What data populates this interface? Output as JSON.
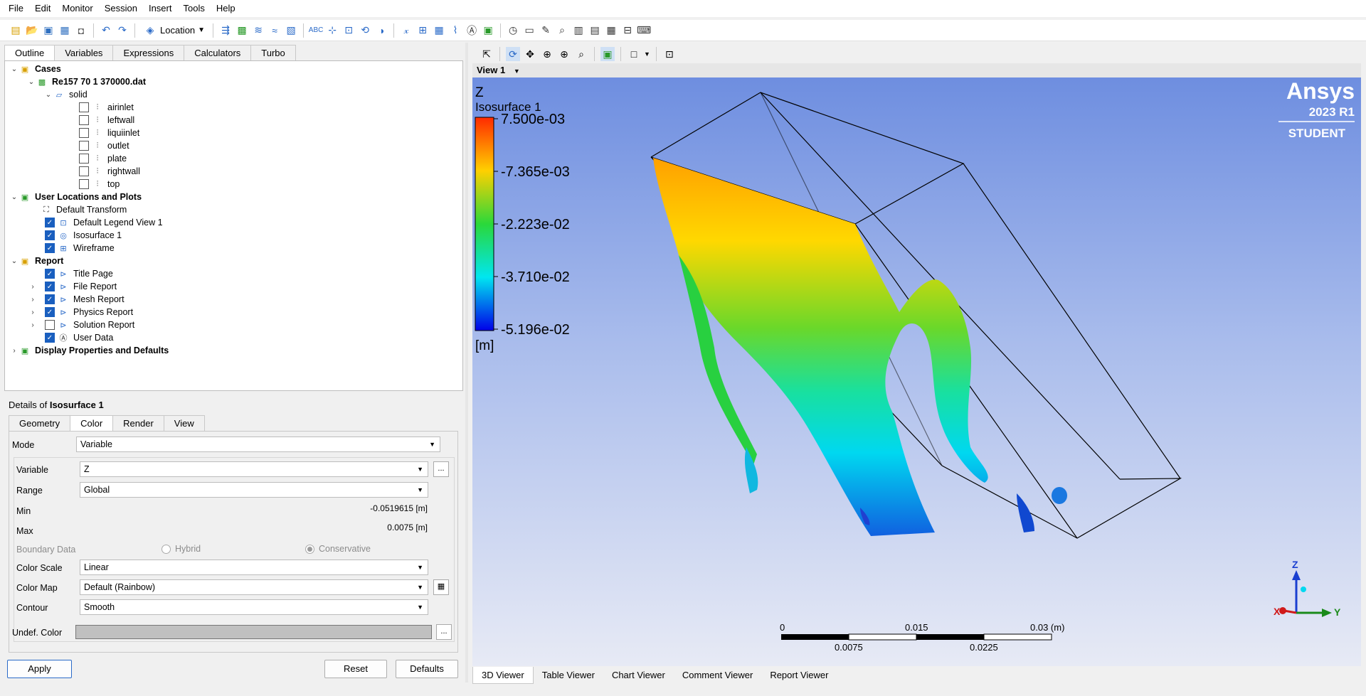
{
  "menu": [
    "File",
    "Edit",
    "Monitor",
    "Session",
    "Insert",
    "Tools",
    "Help"
  ],
  "toolbar": {
    "location_label": "Location"
  },
  "outline_tabs": [
    "Outline",
    "Variables",
    "Expressions",
    "Calculators",
    "Turbo"
  ],
  "tree": {
    "cases": "Cases",
    "case_file": "Re157 70 1 370000.dat",
    "domain": "solid",
    "boundaries": [
      "airinlet",
      "leftwall",
      "liquiinlet",
      "outlet",
      "plate",
      "rightwall",
      "top"
    ],
    "user_locations": "User Locations and Plots",
    "default_transform": "Default Transform",
    "legend": "Default Legend View 1",
    "isosurface": "Isosurface 1",
    "wireframe": "Wireframe",
    "report": "Report",
    "report_items": [
      {
        "label": "Title Page",
        "checked": true
      },
      {
        "label": "File Report",
        "checked": true
      },
      {
        "label": "Mesh Report",
        "checked": true
      },
      {
        "label": "Physics Report",
        "checked": true
      },
      {
        "label": "Solution Report",
        "checked": false
      },
      {
        "label": "User Data",
        "checked": true
      }
    ],
    "display_props": "Display Properties and Defaults"
  },
  "details": {
    "title_prefix": "Details of",
    "title_object": "Isosurface 1",
    "tabs": [
      "Geometry",
      "Color",
      "Render",
      "View"
    ],
    "mode_label": "Mode",
    "mode_value": "Variable",
    "variable_label": "Variable",
    "variable_value": "Z",
    "range_label": "Range",
    "range_value": "Global",
    "min_label": "Min",
    "min_value": "-0.0519615 [m]",
    "max_label": "Max",
    "max_value": "0.0075 [m]",
    "boundary_label": "Boundary Data",
    "hybrid_label": "Hybrid",
    "conservative_label": "Conservative",
    "color_scale_label": "Color Scale",
    "color_scale_value": "Linear",
    "color_map_label": "Color Map",
    "color_map_value": "Default (Rainbow)",
    "contour_label": "Contour",
    "contour_value": "Smooth",
    "undef_label": "Undef. Color",
    "undef_color": "#c0c0c0",
    "ellipsis": "...",
    "apply": "Apply",
    "reset": "Reset",
    "defaults": "Defaults"
  },
  "view": {
    "name": "View 1",
    "legend_var": "Z",
    "legend_name": "Isosurface 1",
    "legend_ticks": [
      "7.500e-03",
      "-7.365e-03",
      "-2.223e-02",
      "-3.710e-02",
      "-5.196e-02"
    ],
    "legend_unit": "[m]",
    "brand": "Ansys",
    "version": "2023 R1",
    "edition": "STUDENT",
    "scale_top": [
      "0",
      "0.015",
      "0.03  (m)"
    ],
    "scale_bottom": [
      "0.0075",
      "0.0225"
    ],
    "axis_z": "Z",
    "axis_x": "X",
    "axis_y": "Y"
  },
  "viewer_tabs": [
    "3D Viewer",
    "Table Viewer",
    "Chart Viewer",
    "Comment Viewer",
    "Report Viewer"
  ]
}
